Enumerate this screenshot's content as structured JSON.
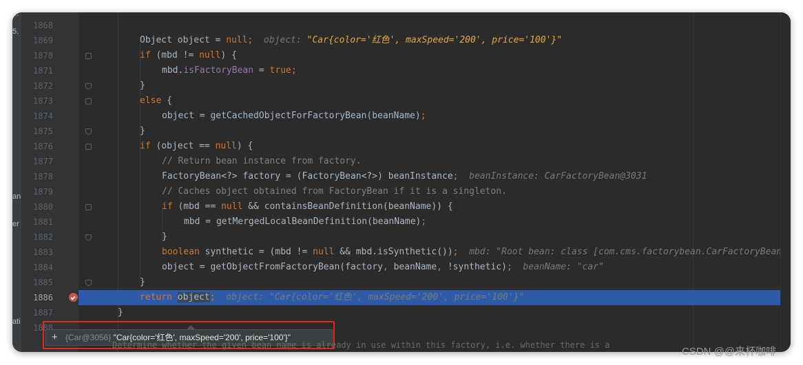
{
  "side_fragments": [
    "4.",
    "5.",
    "an",
    "er",
    "ati"
  ],
  "lines": [
    {
      "n": "1868",
      "indent": 0,
      "parts": []
    },
    {
      "n": "1869",
      "indent": 1,
      "parts": [
        {
          "t": "Object object = ",
          "c": ""
        },
        {
          "t": "null",
          "c": "kw"
        },
        {
          "t": ";  ",
          "c": "kw"
        },
        {
          "t": "object: ",
          "c": "hint"
        },
        {
          "t": "\"Car{color='红色', maxSpeed='200', price='100'}\"",
          "c": "hstr"
        }
      ]
    },
    {
      "n": "1870",
      "indent": 1,
      "parts": [
        {
          "t": "if",
          "c": "kw"
        },
        {
          "t": " (mbd != ",
          "c": ""
        },
        {
          "t": "null",
          "c": "kw"
        },
        {
          "t": ") {",
          "c": ""
        }
      ]
    },
    {
      "n": "1871",
      "indent": 2,
      "parts": [
        {
          "t": "mbd.",
          "c": ""
        },
        {
          "t": "isFactoryBean",
          "c": "fld"
        },
        {
          "t": " = ",
          "c": ""
        },
        {
          "t": "true",
          "c": "kw"
        },
        {
          "t": ";",
          "c": "kw"
        }
      ]
    },
    {
      "n": "1872",
      "indent": 1,
      "parts": [
        {
          "t": "}",
          "c": ""
        }
      ]
    },
    {
      "n": "1873",
      "indent": 1,
      "parts": [
        {
          "t": "else",
          "c": "kw"
        },
        {
          "t": " {",
          "c": ""
        }
      ]
    },
    {
      "n": "1874",
      "indent": 2,
      "parts": [
        {
          "t": "object = getCachedObjectForFactoryBean(beanName)",
          "c": ""
        },
        {
          "t": ";",
          "c": "kw"
        }
      ]
    },
    {
      "n": "1875",
      "indent": 1,
      "parts": [
        {
          "t": "}",
          "c": ""
        }
      ]
    },
    {
      "n": "1876",
      "indent": 1,
      "parts": [
        {
          "t": "if",
          "c": "kw"
        },
        {
          "t": " (object == ",
          "c": ""
        },
        {
          "t": "null",
          "c": "kw"
        },
        {
          "t": ") {",
          "c": ""
        }
      ]
    },
    {
      "n": "1877",
      "indent": 2,
      "parts": [
        {
          "t": "// Return bean instance from factory.",
          "c": "cm"
        }
      ]
    },
    {
      "n": "1878",
      "indent": 2,
      "parts": [
        {
          "t": "FactoryBean<?> factory = (FactoryBean<?>) beanInstance",
          "c": ""
        },
        {
          "t": ";  ",
          "c": "kw"
        },
        {
          "t": "beanInstance: CarFactoryBean@3031",
          "c": "hint"
        }
      ]
    },
    {
      "n": "1879",
      "indent": 2,
      "parts": [
        {
          "t": "// Caches object obtained from FactoryBean if it is a singleton.",
          "c": "cm"
        }
      ]
    },
    {
      "n": "1880",
      "indent": 2,
      "parts": [
        {
          "t": "if",
          "c": "kw"
        },
        {
          "t": " (mbd == ",
          "c": ""
        },
        {
          "t": "null",
          "c": "kw"
        },
        {
          "t": " && containsBeanDefinition(beanName)) {",
          "c": ""
        }
      ]
    },
    {
      "n": "1881",
      "indent": 3,
      "parts": [
        {
          "t": "mbd = getMergedLocalBeanDefinition(beanName)",
          "c": ""
        },
        {
          "t": ";",
          "c": "kw"
        }
      ]
    },
    {
      "n": "1882",
      "indent": 2,
      "parts": [
        {
          "t": "}",
          "c": ""
        }
      ]
    },
    {
      "n": "1883",
      "indent": 2,
      "parts": [
        {
          "t": "boolean",
          "c": "kw"
        },
        {
          "t": " synthetic = (mbd != ",
          "c": ""
        },
        {
          "t": "null",
          "c": "kw"
        },
        {
          "t": " && mbd.isSynthetic())",
          "c": ""
        },
        {
          "t": ";  ",
          "c": "kw"
        },
        {
          "t": "mbd: \"Root bean: class [com.cms.factorybean.CarFactoryBean]",
          "c": "hint"
        }
      ]
    },
    {
      "n": "1884",
      "indent": 2,
      "parts": [
        {
          "t": "object = getObjectFromFactoryBean(factory",
          "c": ""
        },
        {
          "t": ", ",
          "c": "kw"
        },
        {
          "t": "beanName",
          "c": ""
        },
        {
          "t": ", ",
          "c": "kw"
        },
        {
          "t": "!synthetic)",
          "c": ""
        },
        {
          "t": ";  ",
          "c": "kw"
        },
        {
          "t": "beanName: \"car\"",
          "c": "hint"
        }
      ]
    },
    {
      "n": "1885",
      "indent": 1,
      "parts": [
        {
          "t": "}",
          "c": ""
        }
      ]
    },
    {
      "n": "1886",
      "indent": 1,
      "current": true,
      "parts": [
        {
          "t": "return",
          "c": "kw"
        },
        {
          "t": " ",
          "c": ""
        },
        {
          "t": "object",
          "c": "sel"
        },
        {
          "t": ";",
          "c": "kw"
        },
        {
          "t": "  ",
          "c": ""
        },
        {
          "t": "object: \"Car{color='红色', maxSpeed='200', price='100'}\"",
          "c": "hint"
        }
      ]
    },
    {
      "n": "1887",
      "indent": 0,
      "parts": [
        {
          "t": "}",
          "c": ""
        }
      ]
    },
    {
      "n": "1888",
      "indent": 0,
      "parts": []
    }
  ],
  "popup": {
    "plus": "+",
    "ref": "{Car@3056}",
    "value": "\"Car{color='红色', maxSpeed='200', price='100'}\""
  },
  "partial_doc": "Determine whether the given bean name is already in use within this factory, i.e. whether there is a",
  "watermark": "CSDN @@来杯咖啡"
}
